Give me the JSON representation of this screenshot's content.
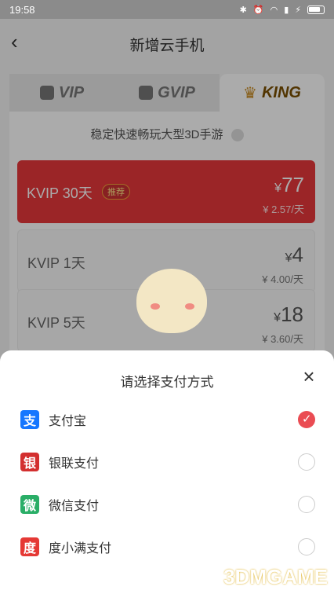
{
  "status_bar": {
    "time": "19:58"
  },
  "header": {
    "title": "新增云手机"
  },
  "tabs": [
    {
      "label": "VIP",
      "active": false
    },
    {
      "label": "GVIP",
      "active": false
    },
    {
      "label": "KING",
      "active": true
    }
  ],
  "panel": {
    "subtitle": "稳定快速畅玩大型3D手游",
    "plans": [
      {
        "name": "KVIP 30天",
        "badge": "推荐",
        "price": "77",
        "currency": "¥",
        "per_day": "¥ 2.57/天",
        "selected": true
      },
      {
        "name": "KVIP 1天",
        "badge": "",
        "price": "4",
        "currency": "¥",
        "per_day": "¥ 4.00/天",
        "selected": false
      },
      {
        "name": "KVIP 5天",
        "badge": "",
        "price": "18",
        "currency": "¥",
        "per_day": "¥ 3.60/天",
        "selected": false
      }
    ]
  },
  "sheet": {
    "title": "请选择支付方式",
    "options": [
      {
        "label": "支付宝",
        "icon": "alipay-icon",
        "selected": true,
        "color": "#1677ff"
      },
      {
        "label": "银联支付",
        "icon": "unionpay-icon",
        "selected": false,
        "color": "#d32f2f"
      },
      {
        "label": "微信支付",
        "icon": "wechat-icon",
        "selected": false,
        "color": "#2aae67"
      },
      {
        "label": "度小满支付",
        "icon": "duxiaoman-icon",
        "selected": false,
        "color": "#e53935"
      }
    ]
  },
  "watermark": "3DMGAME"
}
